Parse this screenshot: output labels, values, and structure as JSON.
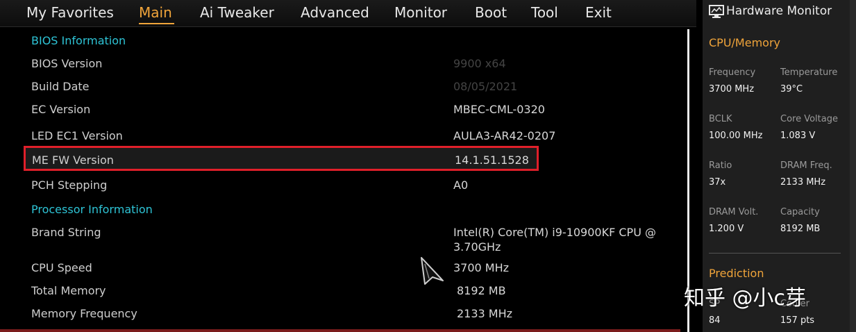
{
  "tabs": {
    "favorites": "My Favorites",
    "main": "Main",
    "ai_tweaker": "Ai Tweaker",
    "advanced": "Advanced",
    "monitor": "Monitor",
    "boot": "Boot",
    "tool": "Tool",
    "exit": "Exit"
  },
  "accent_color": "#f0a43a",
  "section_color": "#2ec4d6",
  "highlight_color": "#e01f2a",
  "bios_info": {
    "title": "BIOS Information",
    "bios_version": {
      "label": "BIOS Version",
      "value": "9900 x64"
    },
    "build_date": {
      "label": "Build Date",
      "value": "08/05/2021"
    },
    "ec_version": {
      "label": "EC Version",
      "value": "MBEC-CML-0320"
    },
    "led_ec1": {
      "label": "LED EC1 Version",
      "value": "AULA3-AR42-0207"
    },
    "me_fw": {
      "label": "ME FW Version",
      "value": "14.1.51.1528"
    },
    "pch": {
      "label": "PCH Stepping",
      "value": "A0"
    }
  },
  "processor_info": {
    "title": "Processor Information",
    "brand": {
      "label": "Brand String",
      "value_line1": "Intel(R) Core(TM) i9-10900KF CPU @",
      "value_line2": "3.70GHz"
    },
    "cpu_speed": {
      "label": "CPU Speed",
      "value": "3700 MHz"
    },
    "total_memory": {
      "label": "Total Memory",
      "value": "8192 MB"
    },
    "mem_freq": {
      "label": "Memory Frequency",
      "value": "2133 MHz"
    }
  },
  "hw_monitor": {
    "icon": "monitor-icon",
    "title": "Hardware Monitor",
    "cpu_memory": {
      "title": "CPU/Memory",
      "frequency": {
        "label": "Frequency",
        "value": "3700 MHz"
      },
      "temperature": {
        "label": "Temperature",
        "value": "39°C"
      },
      "bclk": {
        "label": "BCLK",
        "value": "100.00 MHz"
      },
      "core_voltage": {
        "label": "Core Voltage",
        "value": "1.083 V"
      },
      "ratio": {
        "label": "Ratio",
        "value": "37x"
      },
      "dram_freq": {
        "label": "DRAM Freq.",
        "value": "2133 MHz"
      },
      "dram_volt": {
        "label": "DRAM Volt.",
        "value": "1.200 V"
      },
      "capacity": {
        "label": "Capacity",
        "value": "8192 MB"
      }
    },
    "prediction": {
      "title": "Prediction",
      "sp": {
        "label": "SP",
        "value": "84"
      },
      "cooler": {
        "label": "Cooler",
        "value": "157 pts"
      }
    }
  },
  "watermark": "知乎 @小c芽"
}
